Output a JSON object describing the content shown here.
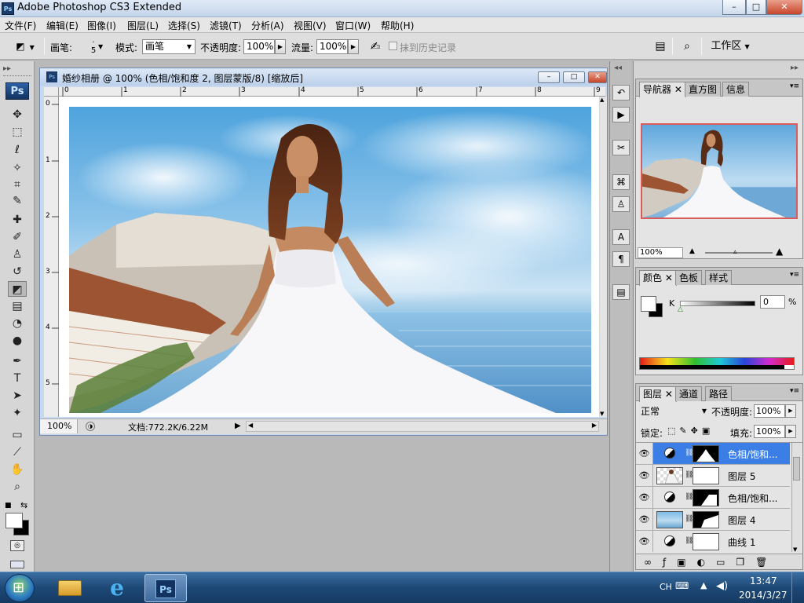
{
  "app": {
    "title": "Adobe Photoshop CS3 Extended",
    "logo": "Ps",
    "window_buttons": [
      "–",
      "□",
      "✕"
    ]
  },
  "menu": [
    "文件(F)",
    "编辑(E)",
    "图像(I)",
    "图层(L)",
    "选择(S)",
    "滤镜(T)",
    "分析(A)",
    "视图(V)",
    "窗口(W)",
    "帮助(H)"
  ],
  "options": {
    "brush_label": "画笔:",
    "brush_size": "5",
    "mode_label": "模式:",
    "mode_value": "画笔",
    "opacity_label": "不透明度:",
    "opacity_value": "100%",
    "flow_label": "流量:",
    "flow_value": "100%",
    "erase_history_label": "抹到历史记录",
    "workspace_label": "工作区"
  },
  "toolbox": {
    "logo": "Ps",
    "tools": [
      {
        "icon": "move-tool-icon",
        "glyph": "✥"
      },
      {
        "icon": "marquee-tool-icon",
        "glyph": "⬚"
      },
      {
        "icon": "lasso-tool-icon",
        "glyph": "ℓ"
      },
      {
        "icon": "magic-wand-tool-icon",
        "glyph": "✧"
      },
      {
        "icon": "crop-tool-icon",
        "glyph": "⌗"
      },
      {
        "icon": "slice-tool-icon",
        "glyph": "✎"
      },
      {
        "icon": "healing-brush-tool-icon",
        "glyph": "✚"
      },
      {
        "icon": "brush-tool-icon",
        "glyph": "✐"
      },
      {
        "icon": "clone-stamp-tool-icon",
        "glyph": "♙"
      },
      {
        "icon": "history-brush-tool-icon",
        "glyph": "↺"
      },
      {
        "icon": "eraser-tool-icon",
        "glyph": "◩"
      },
      {
        "icon": "gradient-tool-icon",
        "glyph": "▤"
      },
      {
        "icon": "blur-tool-icon",
        "glyph": "◔"
      },
      {
        "icon": "dodge-tool-icon",
        "glyph": "●"
      },
      {
        "icon": "pen-tool-icon",
        "glyph": "✒"
      },
      {
        "icon": "type-tool-icon",
        "glyph": "T"
      },
      {
        "icon": "path-selection-tool-icon",
        "glyph": "➤"
      },
      {
        "icon": "shape-tool-icon",
        "glyph": "✦"
      },
      {
        "icon": "notes-tool-icon",
        "glyph": "▭"
      },
      {
        "icon": "eyedropper-tool-icon",
        "glyph": "⟋"
      },
      {
        "icon": "hand-tool-icon",
        "glyph": "✋"
      },
      {
        "icon": "zoom-tool-icon",
        "glyph": "⌕"
      }
    ]
  },
  "document": {
    "title": "婚纱相册 @ 100% (色相/饱和度 2, 图层蒙版/8) [缩放后]",
    "ruler_h": [
      "0",
      "1",
      "2",
      "3",
      "4",
      "5",
      "6",
      "7",
      "8",
      "9"
    ],
    "ruler_v": [
      "0",
      "1",
      "2",
      "3",
      "4",
      "5"
    ],
    "zoom": "100%",
    "doc_info": "文档:772.2K/6.22M"
  },
  "navigator": {
    "tabs": [
      "导航器",
      "直方图",
      "信息"
    ],
    "zoom": "100%"
  },
  "color": {
    "tabs": [
      "颜色",
      "色板",
      "样式"
    ],
    "channel_label": "K",
    "value": "0",
    "unit": "%"
  },
  "layers": {
    "tabs": [
      "图层",
      "通道",
      "路径"
    ],
    "blend_mode": "正常",
    "opacity_label": "不透明度:",
    "opacity_value": "100%",
    "lock_label": "锁定:",
    "fill_label": "填充:",
    "fill_value": "100%",
    "items": [
      {
        "name": "色相/饱和...",
        "type": "adjustment",
        "selected": true
      },
      {
        "name": "图层 5",
        "type": "pixel",
        "selected": false
      },
      {
        "name": "色相/饱和...",
        "type": "adjustment",
        "selected": false
      },
      {
        "name": "图层 4",
        "type": "pixel",
        "selected": false
      },
      {
        "name": "曲线 1",
        "type": "adjustment",
        "selected": false
      }
    ]
  },
  "taskbar": {
    "lang": "CH",
    "time": "13:47",
    "date": "2014/3/27"
  }
}
